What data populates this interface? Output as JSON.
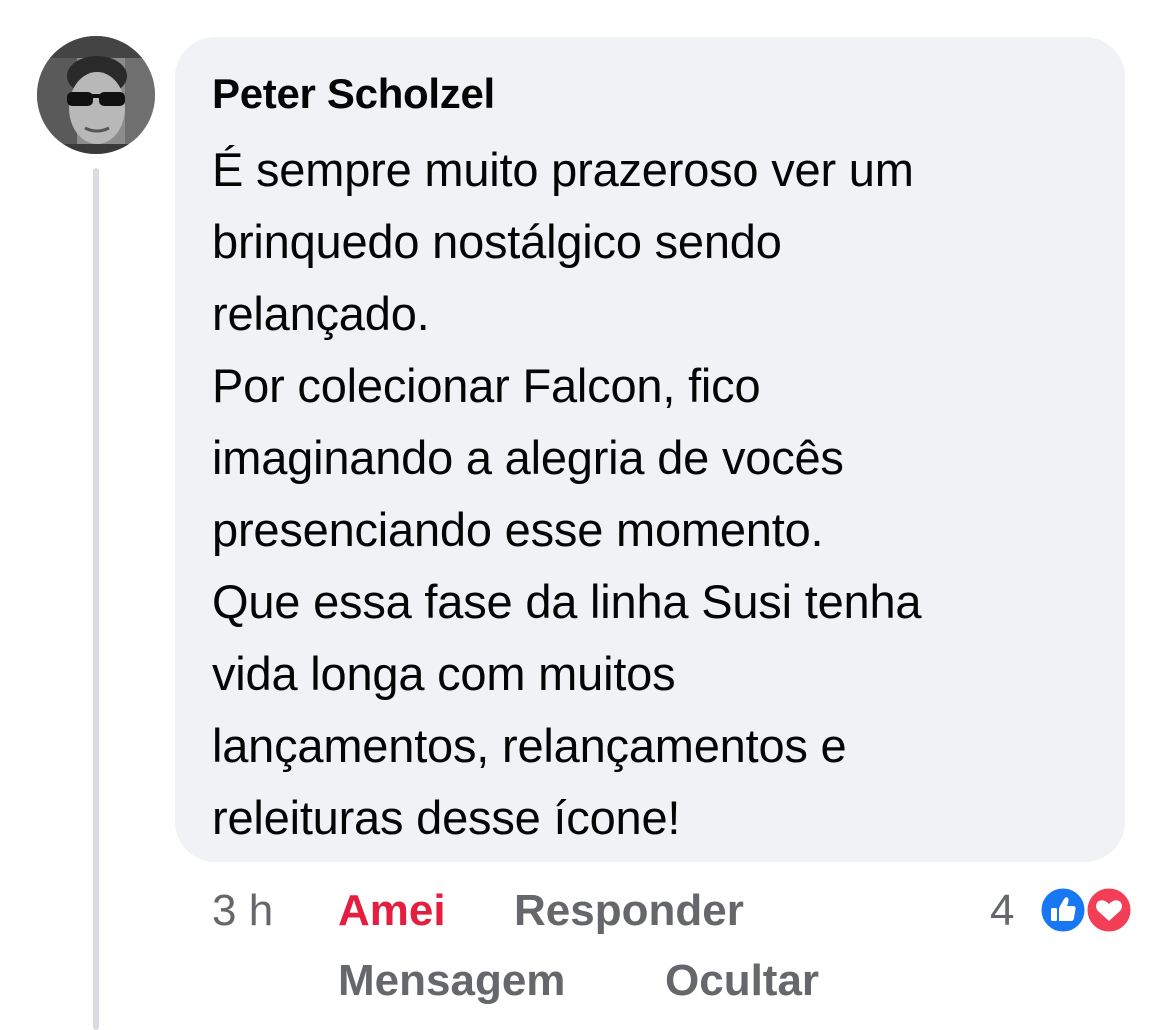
{
  "comment": {
    "author": "Peter Scholzel",
    "body_lines": [
      "É sempre muito prazeroso ver um",
      "brinquedo nostálgico sendo",
      "relançado.",
      "Por colecionar Falcon, fico",
      "imaginando a alegria de vocês",
      "presenciando esse momento.",
      "Que essa fase da linha Susi tenha",
      "vida longa com muitos",
      "lançamentos, relançamentos e",
      "releituras desse ícone!"
    ],
    "timestamp": "3 h",
    "actions": {
      "love": "Amei",
      "reply": "Responder",
      "message": "Mensagem",
      "hide": "Ocultar"
    },
    "reactions": {
      "count": "4",
      "icons": [
        "like-icon",
        "love-icon"
      ]
    }
  },
  "colors": {
    "bubble_bg": "#f0f2f5",
    "text": "#050505",
    "secondary_text": "#65676b",
    "love_red": "#e41e3f",
    "like_blue": "#1877f2",
    "thread_line": "#d9dbe0"
  }
}
